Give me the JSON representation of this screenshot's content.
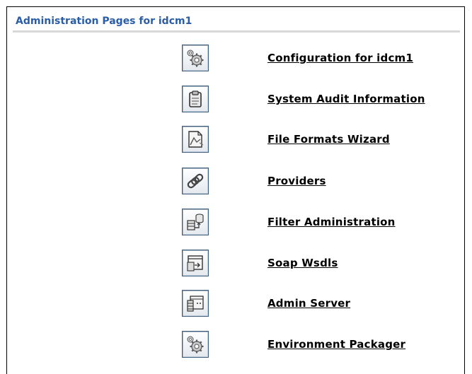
{
  "page": {
    "title": "Administration Pages for idcm1"
  },
  "items": [
    {
      "label": "Configuration for idcm1",
      "icon": "gears-icon"
    },
    {
      "label": "System Audit Information",
      "icon": "clipboard-icon"
    },
    {
      "label": "File Formats Wizard",
      "icon": "document-chart-icon"
    },
    {
      "label": "Providers",
      "icon": "chain-link-icon"
    },
    {
      "label": "Filter Administration",
      "icon": "database-filter-icon"
    },
    {
      "label": "Soap Wsdls",
      "icon": "window-import-icon"
    },
    {
      "label": "Admin Server",
      "icon": "server-window-icon"
    },
    {
      "label": "Environment Packager",
      "icon": "gears-icon"
    }
  ]
}
